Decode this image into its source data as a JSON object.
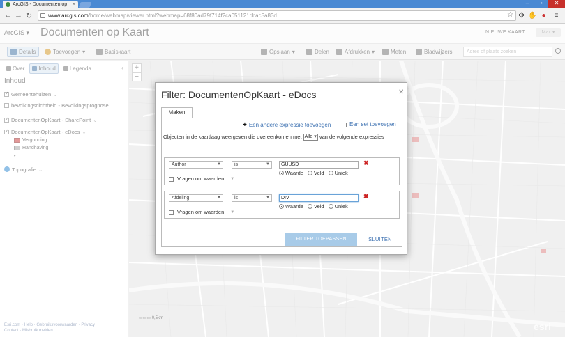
{
  "browser": {
    "tab_title": "ArcGIS - Documenten op",
    "url_host": "www.arcgis.com",
    "url_rest": "/home/webmap/viewer.html?webmap=68f80ad79f714f2ca051121dcac5a83d"
  },
  "app": {
    "brand": "ArcGIS",
    "map_title": "Documenten op Kaart",
    "new_map": "NIEUWE KAART",
    "user": "Max"
  },
  "toolbar": {
    "details": "Details",
    "add": "Toevoegen",
    "basemap": "Basiskaart",
    "save": "Opslaan",
    "share": "Delen",
    "print": "Afdrukken",
    "measure": "Meten",
    "bookmarks": "Bladwijzers",
    "search_placeholder": "Adres of plaats zoeken"
  },
  "sidebar": {
    "tabs": [
      "Over",
      "Inhoud",
      "Legenda"
    ],
    "title": "Inhoud",
    "layers": [
      {
        "label": "Gemeentehuizen",
        "checked": true
      },
      {
        "label": "bevolkingsdichtheid - Bevolkingsprognose",
        "checked": false
      },
      {
        "label": "DocumentenOpKaart - SharePoint",
        "checked": true
      },
      {
        "label": "DocumentenOpKaart - eDocs",
        "checked": true
      }
    ],
    "legend": [
      "Vergunning",
      "Handhaving"
    ],
    "basemap_layer": "Topografie",
    "footer": [
      "Esri.com · Help · Gebruiksvoorwaarden · Privacy",
      "Contact · Misbruik melden"
    ]
  },
  "map": {
    "scale_label": "0,5km",
    "attribution": "esri"
  },
  "dialog": {
    "title": "Filter: DocumentenOpKaart - eDocs",
    "tab": "Maken",
    "add_expression": "Een andere expressie toevoegen",
    "add_set": "Een set toevoegen",
    "desc_before": "Objecten in de kaartlaag weergeven die overeenkomen met",
    "match_mode": "Alle",
    "desc_after": "van de volgende expressies",
    "expressions": [
      {
        "field": "Author",
        "operator": "is",
        "value": "GUUSD",
        "ask": "Vragen om waarden"
      },
      {
        "field": "Afdeling",
        "operator": "is",
        "value": "DIV",
        "ask": "Vragen om waarden"
      }
    ],
    "radio_labels": [
      "Waarde",
      "Veld",
      "Uniek"
    ],
    "apply_button": "FILTER TOEPASSEN",
    "close_button": "SLUITEN"
  }
}
